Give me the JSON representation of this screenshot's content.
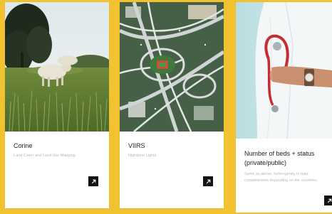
{
  "cards": [
    {
      "title": "Corine",
      "subtitle": "Land Cover and Land Use Mapping",
      "image_subject": "sheep grazing in a green field"
    },
    {
      "title": "VIIRS",
      "subtitle": "Nighttime Lights",
      "image_subject": "aerial view of highway interchange"
    },
    {
      "title_line1": "Number of beds + status",
      "title_line2": "(private/public)",
      "subtitle_line1": "Same as above, heterogenity in data",
      "subtitle_line2": "completeness depending on the countries",
      "image_subject": "doctor holding a stethoscope"
    }
  ],
  "icons": {
    "open_link": "arrow-up-right-icon"
  },
  "colors": {
    "background": "#f2c230",
    "card": "#ffffff",
    "button": "#111111"
  }
}
